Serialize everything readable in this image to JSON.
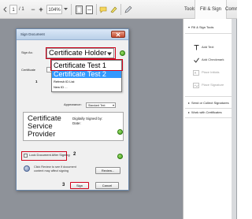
{
  "toolbar": {
    "page_current": "1",
    "page_total": "/ 1",
    "zoom_out": "−",
    "zoom_in": "+",
    "zoom_level": "104%",
    "tabs": [
      "Tools",
      "Fill & Sign",
      "Comme"
    ]
  },
  "panel": {
    "fill_sign_tools": "Fill & Sign Tools",
    "items": [
      {
        "label": "Add Text",
        "icon": "text-icon",
        "enabled": true
      },
      {
        "label": "Add Checkmark",
        "icon": "checkmark-icon",
        "enabled": true
      },
      {
        "label": "Place Initials",
        "icon": "initials-icon",
        "enabled": false
      },
      {
        "label": "Place Signature",
        "icon": "signature-icon",
        "enabled": false
      }
    ],
    "send_collect": "Send or Collect Signatures",
    "work_certificates": "Work with Certificates"
  },
  "dialog": {
    "title": "Sign Document",
    "sign_as_label": "Sign As:",
    "sign_as_value": "Certificate Holder",
    "cert_label": "Certificate",
    "step1": "1",
    "dropdown_items": [
      "Certificate Test 1",
      "Certificate Test 2",
      "Refresh ID List",
      "New ID ..."
    ],
    "appearance_label": "Appearance:",
    "appearance_value": "Standard Text",
    "preview_name": "Certificate Service Provider",
    "preview_digital": "Digitally Signed by:",
    "preview_date": "Date:",
    "lock_label": "Lock Document After Signing",
    "step2": "2",
    "review_text": "Click Review to see if document content may affect signing",
    "review_button": "Review...",
    "step3": "3",
    "sign_button": "Sign",
    "cancel_button": "Cancel"
  },
  "colors": {
    "highlight_red": "#d0021b",
    "selection_blue": "#3399ff",
    "info_green": "#3d9a1c"
  }
}
